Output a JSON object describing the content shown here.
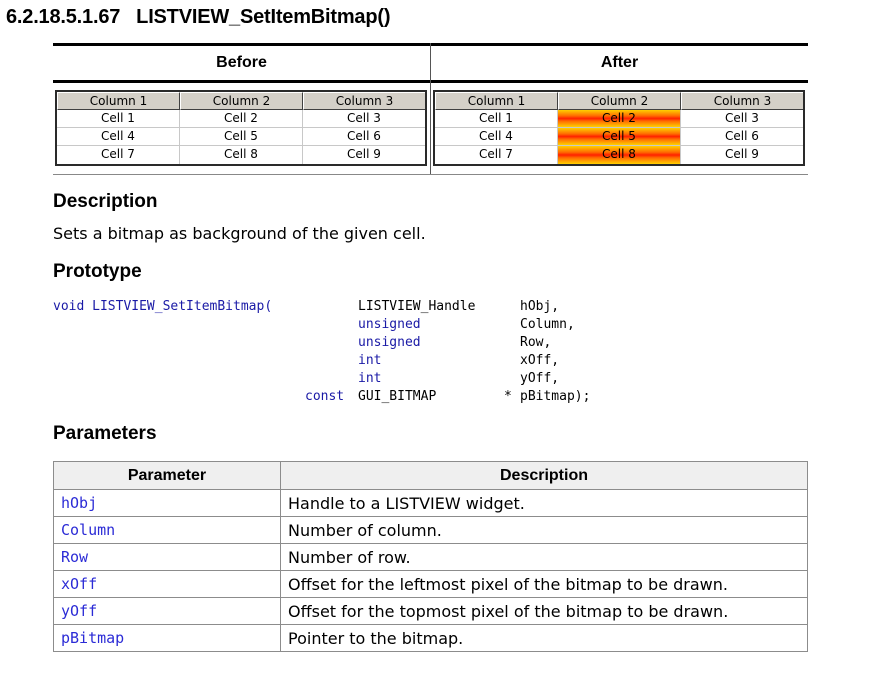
{
  "heading": {
    "number": "6.2.18.5.1.67",
    "title": "LISTVIEW_SetItemBitmap()"
  },
  "comparison": {
    "before_label": "Before",
    "after_label": "After",
    "before": {
      "columns": [
        "Column 1",
        "Column 2",
        "Column 3"
      ],
      "rows": [
        [
          "Cell 1",
          "Cell 2",
          "Cell 3"
        ],
        [
          "Cell 4",
          "Cell 5",
          "Cell 6"
        ],
        [
          "Cell 7",
          "Cell 8",
          "Cell 9"
        ]
      ]
    },
    "after": {
      "columns": [
        "Column 1",
        "Column 2",
        "Column 3"
      ],
      "rows": [
        [
          "Cell 1",
          "Cell 2",
          "Cell 3"
        ],
        [
          "Cell 4",
          "Cell 5",
          "Cell 6"
        ],
        [
          "Cell 7",
          "Cell 8",
          "Cell 9"
        ]
      ],
      "bitmap_color": "#ff3000"
    }
  },
  "description": {
    "title": "Description",
    "text": "Sets a bitmap as background of the given cell."
  },
  "prototype": {
    "title": "Prototype",
    "func": "void LISTVIEW_SetItemBitmap(",
    "params": [
      {
        "type": "LISTVIEW_Handle",
        "name": "hObj,",
        "kw": false
      },
      {
        "type": "unsigned",
        "name": "Column,",
        "kw": true
      },
      {
        "type": "unsigned",
        "name": "Row,",
        "kw": true
      },
      {
        "type": "int",
        "name": "xOff,",
        "kw": true
      },
      {
        "type": "int",
        "name": "yOff,",
        "kw": true
      }
    ],
    "last": {
      "const": "const",
      "type": "GUI_BITMAP",
      "star": "*",
      "name": "pBitmap);"
    }
  },
  "parameters": {
    "title": "Parameters",
    "headers": [
      "Parameter",
      "Description"
    ],
    "rows": [
      {
        "name": "hObj",
        "desc": "Handle to a LISTVIEW widget."
      },
      {
        "name": "Column",
        "desc": "Number of column."
      },
      {
        "name": "Row",
        "desc": "Number of row."
      },
      {
        "name": "xOff",
        "desc": "Offset for the leftmost pixel of the bitmap to be drawn."
      },
      {
        "name": "yOff",
        "desc": "Offset for the topmost pixel of the bitmap to be drawn."
      },
      {
        "name": "pBitmap",
        "desc": "Pointer to the bitmap."
      }
    ]
  }
}
